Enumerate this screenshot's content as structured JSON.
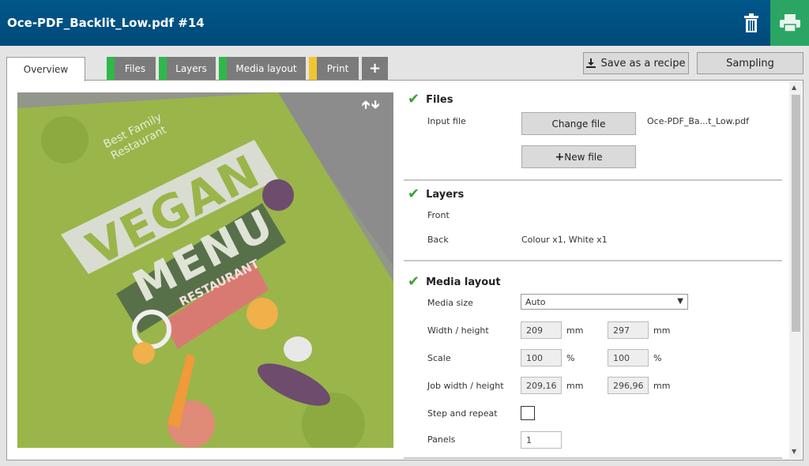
{
  "header": {
    "title": "Oce-PDF_Backlit_Low.pdf #14"
  },
  "tabs": [
    {
      "label": "Overview"
    },
    {
      "label": "Files",
      "stripe": "#2fb84a"
    },
    {
      "label": "Layers",
      "stripe": "#2fb84a"
    },
    {
      "label": "Media layout",
      "stripe": "#2fb84a"
    },
    {
      "label": "Print",
      "stripe": "#f2c530"
    },
    {
      "label": "+"
    }
  ],
  "toolbar": {
    "save_recipe": "Save as a recipe",
    "sampling": "Sampling"
  },
  "preview": {
    "heading_small": "Best Family Restaurant",
    "vegan": "VEGAN",
    "menu": "MENU",
    "restaurant": "RESTAURANT"
  },
  "files": {
    "title": "Files",
    "input_label": "Input file",
    "change_file": "Change file",
    "file_name": "Oce-PDF_Ba...t_Low.pdf",
    "new_file": "New file"
  },
  "layers": {
    "title": "Layers",
    "front_label": "Front",
    "back_label": "Back",
    "back_value": "Colour x1, White x1"
  },
  "media_layout": {
    "title": "Media layout",
    "media_size_label": "Media size",
    "media_size_value": "Auto",
    "wh_label": "Width / height",
    "width": "209",
    "height": "297",
    "unit_mm": "mm",
    "scale_label": "Scale",
    "scale_x": "100",
    "scale_y": "100",
    "unit_pct": "%",
    "job_wh_label": "Job width / height",
    "job_width": "209,16",
    "job_height": "296,96",
    "step_label": "Step and repeat",
    "panels_label": "Panels",
    "panels_value": "1"
  },
  "colors": {
    "accent": "#01568a",
    "print": "#2ba563",
    "check": "#37a337"
  }
}
